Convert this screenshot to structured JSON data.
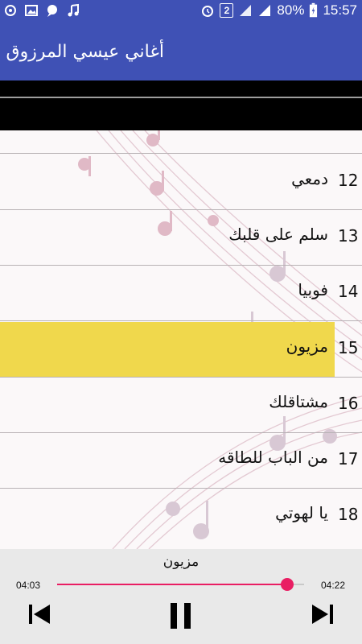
{
  "status_bar": {
    "battery_percent": "80%",
    "sim_badge": "2",
    "time": "15:57",
    "icons": [
      "sync-icon",
      "image-icon",
      "chat-icon",
      "music-note-icon",
      "alarm-icon",
      "signal-icon",
      "signal-icon",
      "battery-icon"
    ]
  },
  "app_bar": {
    "title": "أغاني عيسي المرزوق",
    "color": "#3f51b5"
  },
  "list": {
    "selected_color": "#f0d84c",
    "items": [
      {
        "num": "12",
        "title": "دمعي"
      },
      {
        "num": "13",
        "title": "سلم على قلبك"
      },
      {
        "num": "14",
        "title": "فوبيا"
      },
      {
        "num": "15",
        "title": "مزيون",
        "selected": true
      },
      {
        "num": "16",
        "title": "مشتاقلك"
      },
      {
        "num": "17",
        "title": "من الباب للطاقه"
      },
      {
        "num": "18",
        "title": "يا لهوتي"
      }
    ]
  },
  "player": {
    "now_playing": "مزيون",
    "current_time": "04:03",
    "total_time": "04:22",
    "progress": 0.93,
    "accent": "#e91e63",
    "controls": [
      "previous-icon",
      "pause-icon",
      "next-icon"
    ]
  }
}
